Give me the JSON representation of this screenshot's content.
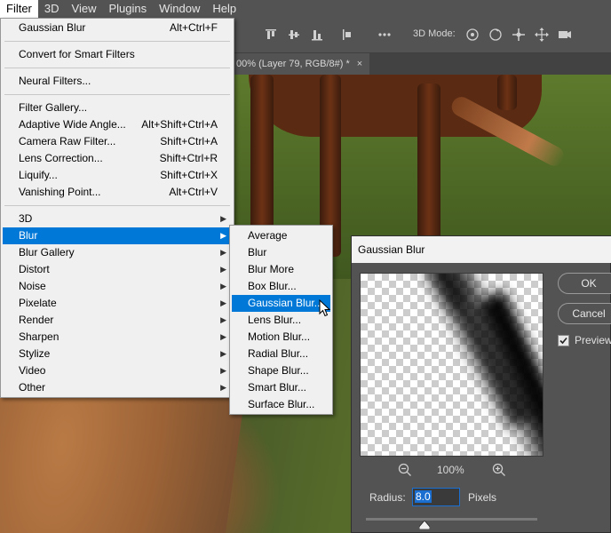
{
  "menubar": {
    "items": [
      "Filter",
      "3D",
      "View",
      "Plugins",
      "Window",
      "Help"
    ],
    "active": "Filter"
  },
  "optionsbar": {
    "mode_label": "3D Mode:"
  },
  "document_tab": {
    "title": "00% (Layer 79, RGB/8#) *",
    "close": "×"
  },
  "filter_menu": {
    "last_filter": {
      "label": "Gaussian Blur",
      "shortcut": "Alt+Ctrl+F"
    },
    "convert": "Convert for Smart Filters",
    "neural": "Neural Filters...",
    "group1": [
      {
        "label": "Filter Gallery...",
        "shortcut": ""
      },
      {
        "label": "Adaptive Wide Angle...",
        "shortcut": "Alt+Shift+Ctrl+A"
      },
      {
        "label": "Camera Raw Filter...",
        "shortcut": "Shift+Ctrl+A"
      },
      {
        "label": "Lens Correction...",
        "shortcut": "Shift+Ctrl+R"
      },
      {
        "label": "Liquify...",
        "shortcut": "Shift+Ctrl+X"
      },
      {
        "label": "Vanishing Point...",
        "shortcut": "Alt+Ctrl+V"
      }
    ],
    "submenus": [
      "3D",
      "Blur",
      "Blur Gallery",
      "Distort",
      "Noise",
      "Pixelate",
      "Render",
      "Sharpen",
      "Stylize",
      "Video",
      "Other"
    ],
    "highlighted": "Blur"
  },
  "blur_menu": {
    "items": [
      "Average",
      "Blur",
      "Blur More",
      "Box Blur...",
      "Gaussian Blur...",
      "Lens Blur...",
      "Motion Blur...",
      "Radial Blur...",
      "Shape Blur...",
      "Smart Blur...",
      "Surface Blur..."
    ],
    "highlighted": "Gaussian Blur..."
  },
  "gaussian_dialog": {
    "title": "Gaussian Blur",
    "ok": "OK",
    "cancel": "Cancel",
    "preview_label": "Preview",
    "preview_checked": true,
    "zoom_percent": "100%",
    "radius_label": "Radius:",
    "radius_value": "8.0",
    "units": "Pixels"
  },
  "colors": {
    "highlight": "#0078d7",
    "menu_bg": "#f0f0f0",
    "panel_bg": "#535353"
  }
}
